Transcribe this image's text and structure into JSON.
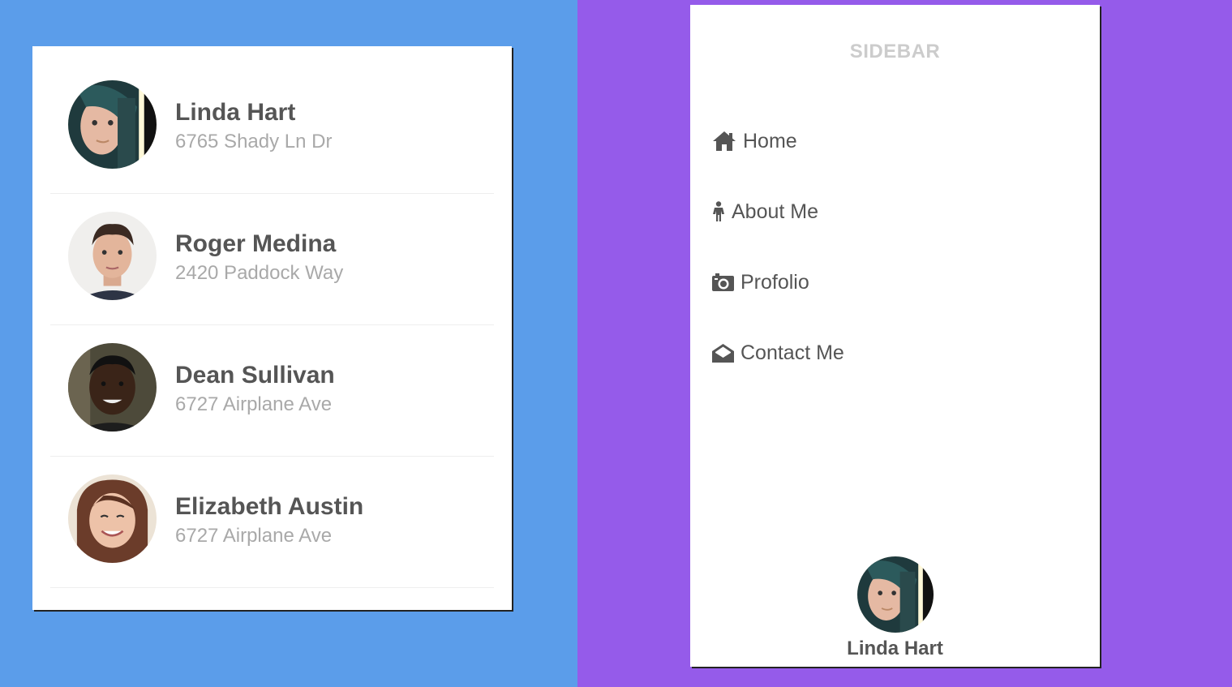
{
  "colors": {
    "left_bg": "#5b9dea",
    "right_bg": "#955bea",
    "card_bg": "#ffffff",
    "name_text": "#555555",
    "address_text": "#a9a9a9",
    "sidebar_title": "#cccccc"
  },
  "contacts": [
    {
      "name": "Linda Hart",
      "address": "6765 Shady Ln Dr"
    },
    {
      "name": "Roger Medina",
      "address": "2420 Paddock Way"
    },
    {
      "name": "Dean Sullivan",
      "address": "6727 Airplane Ave"
    },
    {
      "name": "Elizabeth Austin",
      "address": "6727 Airplane Ave"
    }
  ],
  "sidebar": {
    "title": "SIDEBAR",
    "items": [
      {
        "label": "Home",
        "icon": "home-icon"
      },
      {
        "label": "About Me",
        "icon": "person-icon"
      },
      {
        "label": "Profolio",
        "icon": "camera-icon"
      },
      {
        "label": "Contact Me",
        "icon": "envelope-open-icon"
      }
    ],
    "profile": {
      "name": "Linda Hart"
    }
  }
}
